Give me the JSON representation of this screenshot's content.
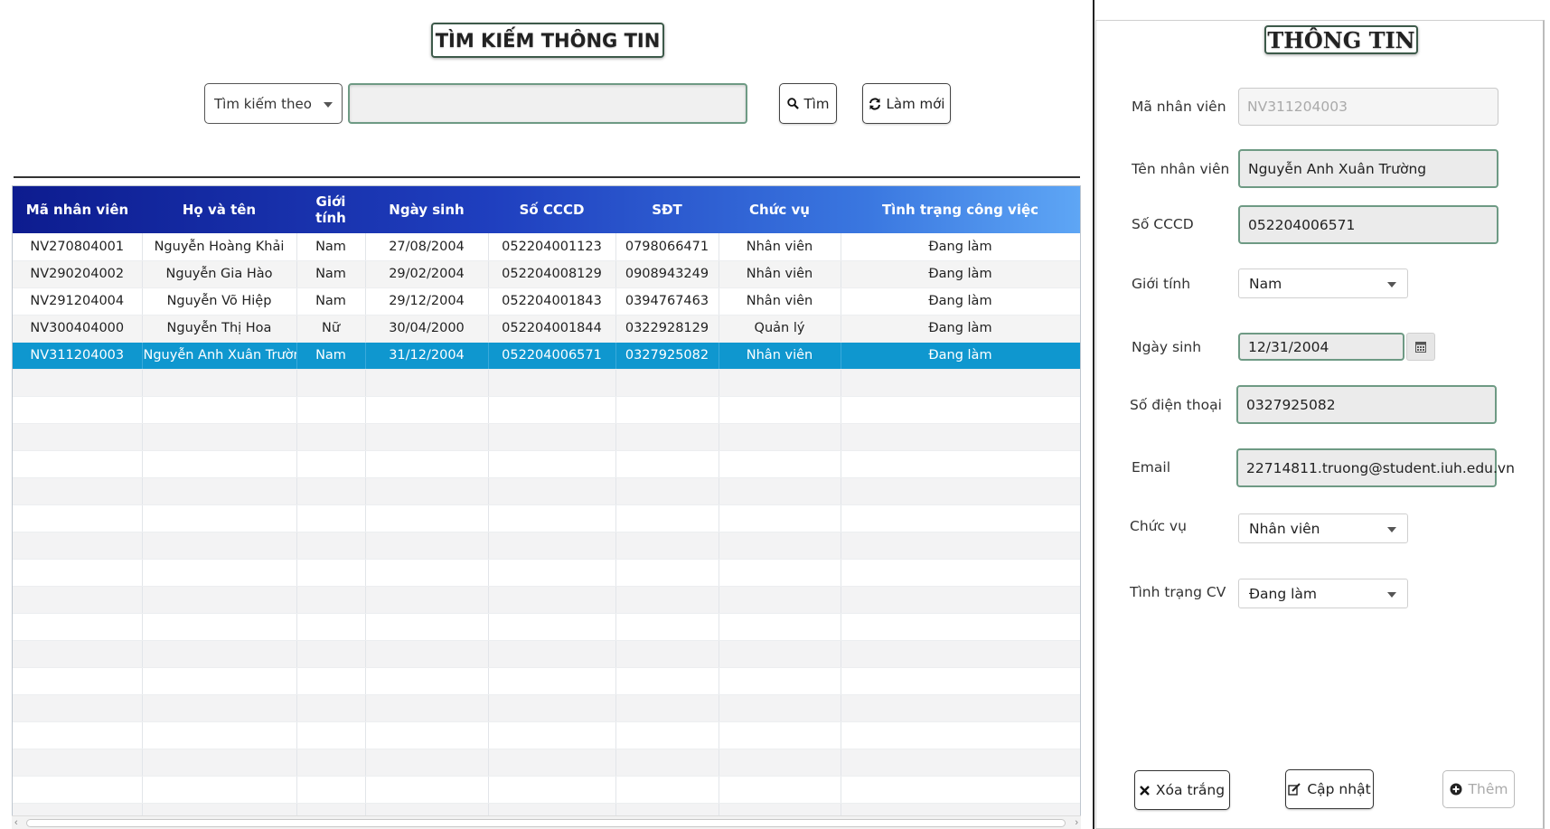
{
  "search": {
    "title": "TÌM KIẾM THÔNG TIN",
    "search_by": "Tìm kiếm theo",
    "query": "",
    "search_button": "Tìm",
    "refresh_button": "Làm mới"
  },
  "table": {
    "columns": [
      "Mã nhân viên",
      "Họ và tên",
      "Giới tính",
      "Ngày sinh",
      "Số CCCD",
      "SĐT",
      "Chức vụ",
      "Tình trạng công việc"
    ],
    "rows": [
      [
        "NV270804001",
        "Nguyễn Hoàng Khải",
        "Nam",
        "27/08/2004",
        "052204001123",
        "0798066471",
        "Nhân viên",
        "Đang làm"
      ],
      [
        "NV290204002",
        "Nguyễn Gia Hào",
        "Nam",
        "29/02/2004",
        "052204008129",
        "0908943249",
        "Nhân viên",
        "Đang làm"
      ],
      [
        "NV291204004",
        "Nguyễn Võ Hiệp",
        "Nam",
        "29/12/2004",
        "052204001843",
        "0394767463",
        "Nhân viên",
        "Đang làm"
      ],
      [
        "NV300404000",
        "Nguyễn Thị Hoa",
        "Nữ",
        "30/04/2000",
        "052204001844",
        "0322928129",
        "Quản lý",
        "Đang làm"
      ],
      [
        "NV311204003",
        "Nguyễn Anh Xuân Trường",
        "Nam",
        "31/12/2004",
        "052204006571",
        "0327925082",
        "Nhân viên",
        "Đang làm"
      ]
    ],
    "selected_row": 4
  },
  "info": {
    "title": "THÔNG TIN",
    "labels": {
      "id": "Mã nhân viên",
      "name": "Tên nhân viên",
      "cccd": "Số CCCD",
      "gender": "Giới tính",
      "dob": "Ngày sinh",
      "phone": "Số điện thoại",
      "email": "Email",
      "position": "Chức vụ",
      "status": "Tình trạng CV"
    },
    "values": {
      "id": "NV311204003",
      "name": "Nguyễn Anh Xuân Trường",
      "cccd": "052204006571",
      "gender": "Nam",
      "dob": "12/31/2004",
      "phone": "0327925082",
      "email": "22714811.truong@student.iuh.edu.vn",
      "position": "Nhân viên",
      "status": "Đang làm"
    },
    "buttons": {
      "clear": "Xóa trắng",
      "update": "Cập nhật",
      "add": "Thêm"
    }
  },
  "colors": {
    "header_start": "#0d1c8f",
    "header_end": "#5ea6f5",
    "selected_row": "#0f97cf",
    "field_border": "#6e9a84"
  },
  "icons": {
    "search": "magnifier-icon",
    "refresh": "refresh-icon",
    "calendar": "calendar-icon",
    "clear": "x-icon",
    "update": "edit-icon",
    "add": "plus-circle-icon"
  }
}
